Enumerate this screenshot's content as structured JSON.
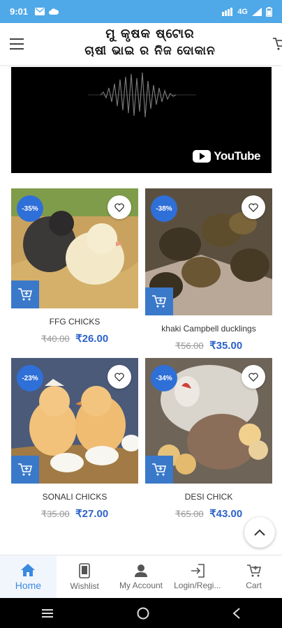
{
  "status_bar": {
    "time": "9:01",
    "network": "4G",
    "icons": [
      "mail-icon",
      "cloud-icon",
      "hd-signal-icon",
      "signal-icon",
      "battery-icon"
    ]
  },
  "header": {
    "title_line1": "ମୁ କୃଷକ ଷ୍ଟୋର",
    "title_line2": "ଚାଷୀ ଭାଇ ର ନିଜ ଦୋକାନ"
  },
  "video": {
    "provider": "YouTube"
  },
  "products": [
    {
      "name": "FFG CHICKS",
      "discount": "-35%",
      "old_price": "₹40.00",
      "price": "₹26.00"
    },
    {
      "name": "khaki Campbell ducklings",
      "discount": "-38%",
      "old_price": "₹56.00",
      "price": "₹35.00"
    },
    {
      "name": "SONALI CHICKS",
      "discount": "-23%",
      "old_price": "₹35.00",
      "price": "₹27.00"
    },
    {
      "name": "DESI CHICK",
      "discount": "-34%",
      "old_price": "₹65.00",
      "price": "₹43.00"
    }
  ],
  "bottom_nav": [
    {
      "label": "Home",
      "icon": "home-icon",
      "active": true
    },
    {
      "label": "Wishlist",
      "icon": "phone-icon",
      "active": false
    },
    {
      "label": "My Account",
      "icon": "user-icon",
      "active": false
    },
    {
      "label": "Login/Regi...",
      "icon": "login-icon",
      "active": false
    },
    {
      "label": "Cart",
      "icon": "cart-icon",
      "active": false
    }
  ],
  "colors": {
    "status_bar": "#4fa8e8",
    "accent_blue": "#2e62c9",
    "discount_badge": "#2f6fd8",
    "cart_button": "#3a79c9",
    "active_nav": "#3a8ae0"
  }
}
